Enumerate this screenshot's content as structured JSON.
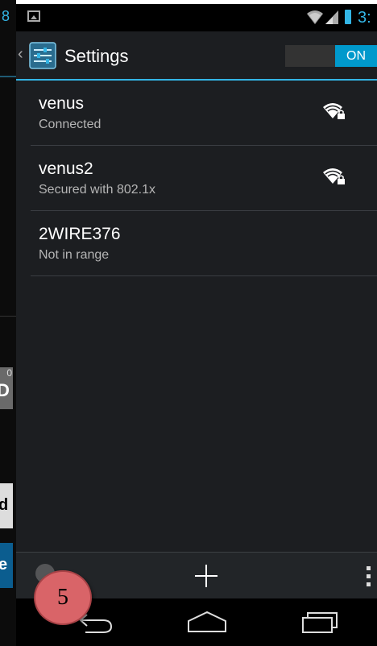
{
  "background_app": {
    "top_fragment": "8",
    "button1_badge": "0",
    "button1_text": "D",
    "button2_text": "d",
    "button3_text": "e"
  },
  "status_bar": {
    "time": "3:",
    "icons": [
      "picture-notification-icon",
      "wifi-signal-icon",
      "cell-signal-icon",
      "battery-icon"
    ]
  },
  "action_bar": {
    "back_glyph": "‹",
    "title": "Settings",
    "toggle_label": "ON",
    "toggle_state": "on"
  },
  "networks": [
    {
      "name": "venus",
      "status": "Connected",
      "signal_icon": "wifi-locked-icon"
    },
    {
      "name": "venus2",
      "status": "Secured with 802.1x",
      "signal_icon": "wifi-locked-icon"
    },
    {
      "name": "2WIRE376",
      "status": "Not in range"
    }
  ],
  "bottom_bar": {
    "icons": [
      "add-network-icon",
      "overflow-menu-icon"
    ]
  },
  "nav_bar": {
    "icons": [
      "back-icon",
      "home-icon",
      "recent-apps-icon"
    ]
  },
  "annotation": {
    "step_number": "5"
  },
  "colors": {
    "accent": "#33b5e5",
    "toggle_on": "#0099cc",
    "panel_bg": "#1c1e21",
    "badge": "#d96468"
  }
}
